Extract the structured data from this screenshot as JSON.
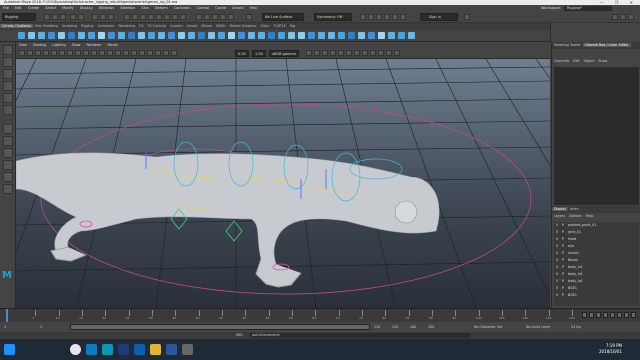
{
  "window": {
    "title": "Autodesk Maya 2018: F:\\2018\\pluralsight\\character_rigging_rebuild\\gecko\\scenes\\gecko_rig_04.ma",
    "controls": "—  ❐  ✕"
  },
  "menubar": [
    "File",
    "Edit",
    "Create",
    "Select",
    "Modify",
    "Display",
    "Windows",
    "Skeleton",
    "Skin",
    "Deform",
    "Constrain",
    "Control",
    "Cache",
    "Arnold",
    "Help"
  ],
  "workspace": {
    "label": "Workspace:",
    "value": "Rigging*"
  },
  "statusline": {
    "mode_menu": "Rigging",
    "live_surface": "No Live Surface",
    "symmetry": "Symmetry: Off",
    "sign_in": "Sign In"
  },
  "shelf_tabs": [
    "Curves / Surfaces",
    "Poly Modeling",
    "Sculpting",
    "Rigging",
    "Animation",
    "Rendering",
    "FX",
    "FX Caching",
    "Custom",
    "Arnold",
    "Bifrost",
    "MASH",
    "Motion Graphics",
    "XGen",
    "TURTLE",
    "Rig"
  ],
  "shelf_active": "Curves / Surfaces",
  "panel_menu": [
    "View",
    "Shading",
    "Lighting",
    "Show",
    "Renderer",
    "Panels"
  ],
  "panel_values": {
    "near": "0.00",
    "far": "1.00",
    "color_space": "sRGB gamma"
  },
  "right_panel": {
    "tabs": [
      "Modeling Toolkit",
      "Channel Box / Layer Editor"
    ],
    "menu": [
      "Channels",
      "Edit",
      "Object",
      "Show"
    ],
    "display_tabs": [
      "Display",
      "Anim"
    ],
    "display_menu": [
      "Layers",
      "Options",
      "Help"
    ],
    "layers": [
      {
        "v": "V",
        "p": "P",
        "name": "pointed_point_01"
      },
      {
        "v": "V",
        "p": "P",
        "name": "joint_01"
      },
      {
        "v": "V",
        "p": "P",
        "name": "head"
      },
      {
        "v": "V",
        "p": "P",
        "name": "eye"
      },
      {
        "v": "V",
        "p": "P",
        "name": "mouth"
      },
      {
        "v": "V",
        "p": "P",
        "name": "Bones"
      },
      {
        "v": "V",
        "p": "P",
        "name": "body_hi1"
      },
      {
        "v": "V",
        "p": "P",
        "name": "body_lo1"
      },
      {
        "v": "V",
        "p": "P",
        "name": "body_lo1"
      },
      {
        "v": "V",
        "p": "P",
        "name": "BGE1"
      },
      {
        "v": "V",
        "p": "P",
        "name": "BGE1"
      }
    ]
  },
  "timeline": {
    "ticks": [
      "5",
      "10",
      "15",
      "20",
      "25",
      "30",
      "35",
      "40",
      "45",
      "50",
      "55",
      "60",
      "65",
      "70",
      "75",
      "80",
      "85",
      "90",
      "95",
      "100",
      "105",
      "110",
      "115",
      "120"
    ],
    "current": "1"
  },
  "range": {
    "start": "1",
    "inner_start": "1",
    "inner_end": "120",
    "end": "120",
    "outer_end": "200",
    "outer_end2": "200",
    "character_set": "No Character Set",
    "anim_layer": "No Anim Layer",
    "fps": "24 fps"
  },
  "mel": {
    "label": "MEL",
    "text": "pointConstraint;"
  },
  "taskbar": {
    "time": "7:19 PM",
    "date": "2018/10/01",
    "icons": [
      "windows-start",
      "chrome",
      "explorer",
      "maya",
      "photoshop",
      "mail",
      "folder",
      "word",
      "task"
    ]
  },
  "colors": {
    "accent": "#3f8fd9",
    "viewport_top": "#6f7f91",
    "viewport_bottom": "#2a3039"
  }
}
